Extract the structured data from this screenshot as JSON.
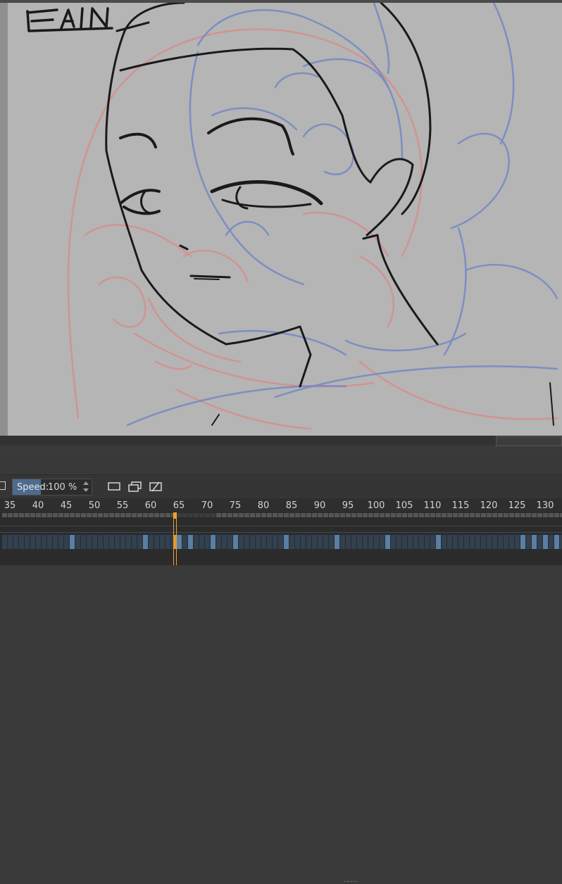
{
  "canvas": {
    "sketch_text": "ERAIN.",
    "colors": {
      "paper": "#b5b5b5",
      "ink": "#1a1a1a",
      "blue_sketch": "#6f86c4",
      "red_sketch": "#d98a86"
    }
  },
  "toolbar": {
    "speed_label": "Speed:",
    "speed_value": "100 %",
    "speed_fraction": 0.36
  },
  "timeline": {
    "ruler_labels": [
      "35",
      "40",
      "45",
      "50",
      "55",
      "60",
      "65",
      "70",
      "75",
      "80",
      "85",
      "90",
      "95",
      "100",
      "105",
      "110",
      "115",
      "120",
      "125",
      "130"
    ],
    "current_frame": 65,
    "keyframes": [
      46,
      59,
      65,
      67,
      71,
      75,
      84,
      93,
      102,
      111,
      126,
      128,
      130,
      132,
      134
    ],
    "accent_color": "#f0a030",
    "key_color": "#5a7fa6"
  }
}
